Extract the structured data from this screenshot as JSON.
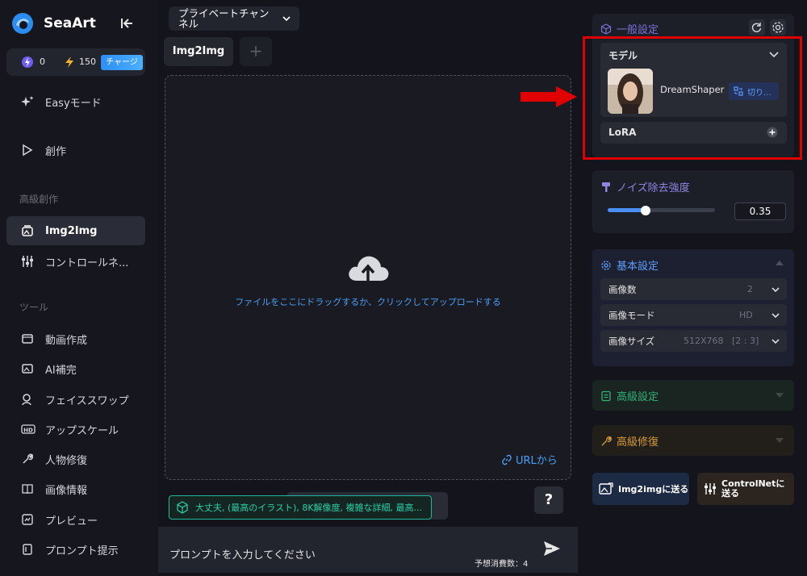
{
  "app": {
    "name": "SeaArt"
  },
  "credits": {
    "energy": "0",
    "bolt": "150",
    "charge_label": "チャージ"
  },
  "sidebar": {
    "easy": "Easyモード",
    "create": "創作",
    "advanced_section": "高級創作",
    "img2img": "Img2Img",
    "controlnet": "コントロールネ...",
    "tools_section": "ツール",
    "tools": [
      "動画作成",
      "AI補完",
      "フェイススワップ",
      "アップスケール",
      "人物修復",
      "画像情報",
      "プレビュー",
      "プロンプト提示"
    ]
  },
  "center": {
    "channel": "プライベートチャンネル",
    "tab": "Img2Img",
    "tab_add": "+",
    "upload_text": "ファイルをここにドラッグするか、クリックしてアップロードする",
    "url_link": "URLから",
    "help": "?",
    "chip": "大丈夫, (最高のイラスト), 8K解像度, 複雑な詳細, 最高...",
    "prompt_placeholder": "プロンプトを入力してください",
    "estimate": "予想消費数：4"
  },
  "general": {
    "title": "一般設定",
    "model_label": "モデル",
    "model_name": "DreamShaper",
    "switch_label": "切り...",
    "lora_label": "LoRA"
  },
  "denoise": {
    "title": "ノイズ除去強度",
    "value": "0.35",
    "fraction": 0.35
  },
  "basic": {
    "title": "基本設定",
    "rows": [
      {
        "label": "画像数",
        "value": "2"
      },
      {
        "label": "画像モード",
        "value": "HD"
      },
      {
        "label": "画像サイズ",
        "value": "512X768   [2 : 3]"
      }
    ]
  },
  "advanced": {
    "title": "高級設定"
  },
  "repair": {
    "title": "高級修復"
  },
  "actions": {
    "send_img2img": "Img2imgに送る",
    "send_controlnet": "ControlNetに送る"
  },
  "colors": {
    "accent": "#4a9ff5",
    "highlight": "#e00000",
    "chip": "#1fb89a",
    "repair": "#d79b3c",
    "advanced": "#2fb37a"
  }
}
